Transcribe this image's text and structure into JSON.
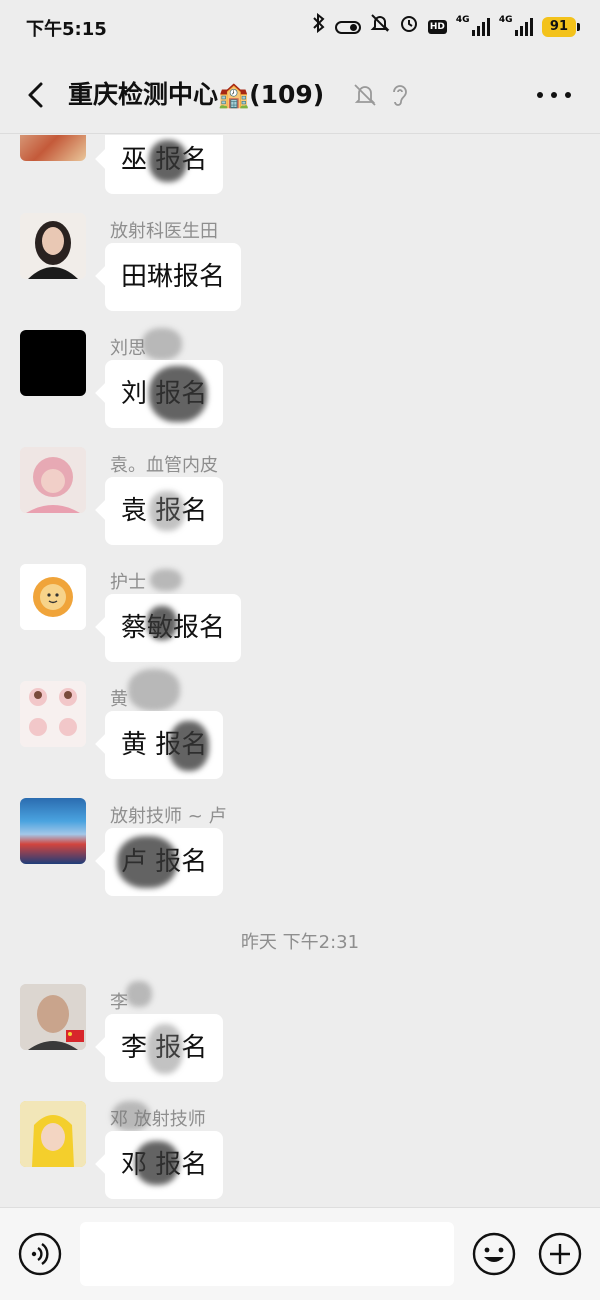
{
  "status_bar": {
    "time": "下午5:15",
    "network_1": "4G",
    "network_2": "4G",
    "hd_badge": "HD",
    "battery": "91",
    "icons": [
      "bluetooth-icon",
      "vibrate-icon",
      "dnd-icon",
      "alarm-icon",
      "hd-icon",
      "signal-icon",
      "signal-icon",
      "battery-icon"
    ]
  },
  "nav": {
    "title": "重庆检测中心",
    "title_emoji": "🏫",
    "member_count": "(109)",
    "icons": [
      "back-icon",
      "mute-bell-icon",
      "ear-icon",
      "more-icon"
    ]
  },
  "messages": [
    {
      "sender": "",
      "text": "巫 报名"
    },
    {
      "sender": "放射科医生田",
      "text": "田琳报名"
    },
    {
      "sender": "刘思",
      "text": "刘 报名"
    },
    {
      "sender": "袁。血管内皮",
      "text": "袁 报名"
    },
    {
      "sender": "护士",
      "text": "蔡敏报名"
    },
    {
      "sender": "黄",
      "text": "黄 报名"
    },
    {
      "sender": "放射技师 ~ 卢",
      "text": "卢 报名"
    },
    {
      "sender": "李",
      "text": "李 报名"
    },
    {
      "sender": "邓 放射技师",
      "text": "邓 报名"
    }
  ],
  "timestamp": "昨天 下午2:31",
  "input_bar": {
    "placeholder": "",
    "icons": [
      "voice-icon",
      "emoji-icon",
      "plus-icon"
    ]
  },
  "colors": {
    "background": "#ededed",
    "bubble": "#ffffff",
    "secondary_text": "#8e8e8e",
    "battery": "#f3c21b"
  }
}
